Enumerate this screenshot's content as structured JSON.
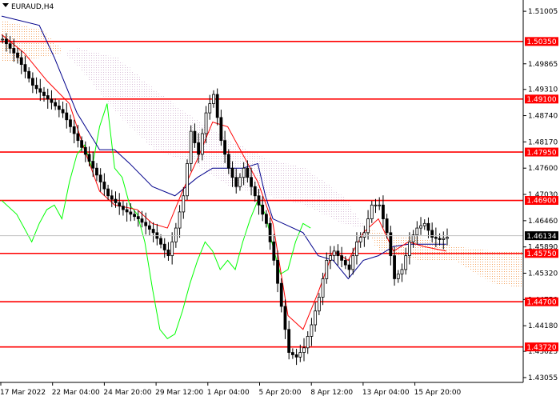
{
  "chart_data": {
    "type": "candlestick",
    "symbol": "EURAUD,H4",
    "current_price": "1.46134",
    "y_axis": {
      "ylim": [
        1.4295,
        1.5125
      ],
      "ticks": [
        {
          "value": 1.51005,
          "label": "1.51005"
        },
        {
          "value": 1.49865,
          "label": "1.49865"
        },
        {
          "value": 1.4931,
          "label": "1.49310"
        },
        {
          "value": 1.4874,
          "label": "1.48740"
        },
        {
          "value": 1.4817,
          "label": "1.48170"
        },
        {
          "value": 1.476,
          "label": "1.47600"
        },
        {
          "value": 1.4703,
          "label": "1.47030"
        },
        {
          "value": 1.4646,
          "label": "1.46460"
        },
        {
          "value": 1.4589,
          "label": "1.45890"
        },
        {
          "value": 1.4532,
          "label": "1.45320"
        },
        {
          "value": 1.4475,
          "label": "1.44750"
        },
        {
          "value": 1.4418,
          "label": "1.44180"
        },
        {
          "value": 1.43625,
          "label": "1.43625"
        },
        {
          "value": 1.43055,
          "label": "1.43055"
        }
      ]
    },
    "x_labels": [
      {
        "label": "17 Mar 2022",
        "pos": 0
      },
      {
        "label": "22 Mar 04:00",
        "pos": 1
      },
      {
        "label": "24 Mar 20:00",
        "pos": 2
      },
      {
        "label": "29 Mar 12:00",
        "pos": 3
      },
      {
        "label": "1 Apr 04:00",
        "pos": 4
      },
      {
        "label": "5 Apr 20:00",
        "pos": 5
      },
      {
        "label": "8 Apr 12:00",
        "pos": 6
      },
      {
        "label": "13 Apr 04:00",
        "pos": 7
      },
      {
        "label": "15 Apr 20:00",
        "pos": 8
      }
    ],
    "levels": [
      {
        "value": 1.5035,
        "label": "1.50350"
      },
      {
        "value": 1.491,
        "label": "1.49100"
      },
      {
        "value": 1.4795,
        "label": "1.47950"
      },
      {
        "value": 1.469,
        "label": "1.46900"
      },
      {
        "value": 1.4575,
        "label": "1.45750"
      },
      {
        "value": 1.447,
        "label": "1.44700"
      },
      {
        "value": 1.4372,
        "label": "1.43720"
      }
    ],
    "close_path": [
      [
        0,
        1.504
      ],
      [
        4,
        1.5
      ],
      [
        8,
        1.494
      ],
      [
        12,
        1.491
      ],
      [
        16,
        1.488
      ],
      [
        20,
        1.482
      ],
      [
        24,
        1.476
      ],
      [
        28,
        1.47
      ],
      [
        32,
        1.467
      ],
      [
        36,
        1.465
      ],
      [
        40,
        1.462
      ],
      [
        44,
        1.457
      ],
      [
        46,
        1.463
      ],
      [
        48,
        1.47
      ],
      [
        50,
        1.484
      ],
      [
        52,
        1.479
      ],
      [
        54,
        1.488
      ],
      [
        56,
        1.492
      ],
      [
        58,
        1.482
      ],
      [
        60,
        1.476
      ],
      [
        62,
        1.472
      ],
      [
        64,
        1.476
      ],
      [
        66,
        1.472
      ],
      [
        68,
        1.468
      ],
      [
        70,
        1.464
      ],
      [
        72,
        1.456
      ],
      [
        74,
        1.446
      ],
      [
        76,
        1.436
      ],
      [
        78,
        1.435
      ],
      [
        80,
        1.437
      ],
      [
        82,
        1.442
      ],
      [
        84,
        1.448
      ],
      [
        86,
        1.456
      ],
      [
        88,
        1.458
      ],
      [
        90,
        1.456
      ],
      [
        92,
        1.454
      ],
      [
        94,
        1.46
      ],
      [
        96,
        1.462
      ],
      [
        98,
        1.468
      ],
      [
        100,
        1.468
      ],
      [
        102,
        1.462
      ],
      [
        104,
        1.452
      ],
      [
        106,
        1.454
      ],
      [
        108,
        1.46
      ],
      [
        110,
        1.463
      ],
      [
        112,
        1.464
      ],
      [
        114,
        1.461
      ],
      [
        116,
        1.4605
      ],
      [
        118,
        1.461
      ]
    ],
    "kijun_path": [
      [
        0,
        1.509
      ],
      [
        10,
        1.507
      ],
      [
        14,
        1.5
      ],
      [
        20,
        1.488
      ],
      [
        26,
        1.48
      ],
      [
        30,
        1.48
      ],
      [
        34,
        1.477
      ],
      [
        40,
        1.472
      ],
      [
        46,
        1.47
      ],
      [
        52,
        1.474
      ],
      [
        56,
        1.476
      ],
      [
        64,
        1.476
      ],
      [
        68,
        1.477
      ],
      [
        70,
        1.47
      ],
      [
        72,
        1.465
      ],
      [
        80,
        1.462
      ],
      [
        84,
        1.457
      ],
      [
        88,
        1.456
      ],
      [
        92,
        1.452
      ],
      [
        96,
        1.456
      ],
      [
        100,
        1.457
      ],
      [
        104,
        1.459
      ],
      [
        108,
        1.4595
      ],
      [
        118,
        1.4595
      ]
    ],
    "tenkan_path": [
      [
        0,
        1.505
      ],
      [
        6,
        1.501
      ],
      [
        12,
        1.495
      ],
      [
        18,
        1.49
      ],
      [
        22,
        1.48
      ],
      [
        26,
        1.471
      ],
      [
        30,
        1.468
      ],
      [
        36,
        1.467
      ],
      [
        40,
        1.464
      ],
      [
        44,
        1.463
      ],
      [
        48,
        1.471
      ],
      [
        52,
        1.478
      ],
      [
        56,
        1.486
      ],
      [
        60,
        1.485
      ],
      [
        64,
        1.479
      ],
      [
        68,
        1.473
      ],
      [
        72,
        1.464
      ],
      [
        76,
        1.444
      ],
      [
        80,
        1.441
      ],
      [
        84,
        1.449
      ],
      [
        88,
        1.458
      ],
      [
        92,
        1.456
      ],
      [
        96,
        1.462
      ],
      [
        100,
        1.465
      ],
      [
        104,
        1.458
      ],
      [
        108,
        1.46
      ],
      [
        112,
        1.459
      ],
      [
        118,
        1.458
      ]
    ],
    "chikou_path": [
      [
        0,
        1.469
      ],
      [
        4,
        1.466
      ],
      [
        8,
        1.46
      ],
      [
        10,
        1.464
      ],
      [
        12,
        1.467
      ],
      [
        14,
        1.468
      ],
      [
        16,
        1.465
      ],
      [
        18,
        1.473
      ],
      [
        20,
        1.479
      ],
      [
        22,
        1.481
      ],
      [
        24,
        1.476
      ],
      [
        26,
        1.485
      ],
      [
        28,
        1.49
      ],
      [
        30,
        1.476
      ],
      [
        32,
        1.474
      ],
      [
        34,
        1.468
      ],
      [
        36,
        1.466
      ],
      [
        38,
        1.46
      ],
      [
        40,
        1.45
      ],
      [
        42,
        1.441
      ],
      [
        44,
        1.439
      ],
      [
        46,
        1.44
      ],
      [
        48,
        1.445
      ],
      [
        50,
        1.451
      ],
      [
        52,
        1.456
      ],
      [
        54,
        1.46
      ],
      [
        56,
        1.458
      ],
      [
        58,
        1.454
      ],
      [
        60,
        1.456
      ],
      [
        62,
        1.454
      ],
      [
        64,
        1.46
      ],
      [
        66,
        1.465
      ],
      [
        68,
        1.469
      ],
      [
        70,
        1.466
      ],
      [
        72,
        1.459
      ],
      [
        74,
        1.453
      ],
      [
        76,
        1.454
      ],
      [
        78,
        1.46
      ],
      [
        80,
        1.464
      ],
      [
        82,
        1.463
      ]
    ],
    "cloud_span_a": [
      [
        0,
        1.508
      ],
      [
        10,
        1.506
      ],
      [
        20,
        1.498
      ],
      [
        30,
        1.488
      ],
      [
        40,
        1.48
      ],
      [
        50,
        1.477
      ],
      [
        60,
        1.472
      ],
      [
        70,
        1.47
      ],
      [
        80,
        1.468
      ],
      [
        90,
        1.464
      ],
      [
        100,
        1.462
      ],
      [
        110,
        1.461
      ],
      [
        120,
        1.459
      ],
      [
        130,
        1.458
      ],
      [
        138,
        1.458
      ]
    ],
    "cloud_span_b": [
      [
        0,
        1.499
      ],
      [
        10,
        1.5
      ],
      [
        20,
        1.502
      ],
      [
        30,
        1.5
      ],
      [
        40,
        1.493
      ],
      [
        50,
        1.487
      ],
      [
        60,
        1.482
      ],
      [
        70,
        1.478
      ],
      [
        80,
        1.476
      ],
      [
        90,
        1.47
      ],
      [
        100,
        1.458
      ],
      [
        110,
        1.456
      ],
      [
        120,
        1.456
      ],
      [
        130,
        1.451
      ],
      [
        138,
        1.45
      ]
    ],
    "colors": {
      "level": "#ff0000",
      "label_bg": "#ff0000",
      "current_bg": "#000000",
      "tenkan": "#ff0000",
      "kijun": "#00008b",
      "chikou": "#00ff00",
      "cloud_up": "#f4a460",
      "cloud_down": "#d8bfd8",
      "candle": "#000000",
      "grid": "#c0c0c0"
    }
  }
}
